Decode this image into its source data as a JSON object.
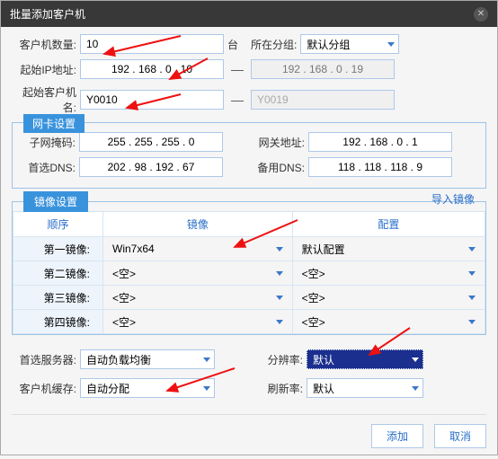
{
  "title": "批量添加客户机",
  "client_count_label": "客户机数量:",
  "client_count_value": "10",
  "client_count_unit": "台",
  "group_in_label": "所在分组:",
  "group_in_value": "默认分组",
  "start_ip_label": "起始IP地址:",
  "start_ip_value": "192 . 168 . 0 . 10",
  "end_ip_value": "192 . 168 . 0 . 19",
  "start_name_label": "起始客户机名:",
  "start_name_value": "Y0010",
  "end_name_value": "Y0019",
  "nic_title": "网卡设置",
  "subnet_label": "子网掩码:",
  "subnet_value": "255 . 255 . 255 . 0",
  "gateway_label": "网关地址:",
  "gateway_value": "192 . 168 . 0 . 1",
  "dns1_label": "首选DNS:",
  "dns1_value": "202 . 98 . 192 . 67",
  "dns2_label": "备用DNS:",
  "dns2_value": "118 . 118 . 118 . 9",
  "img_title": "镜像设置",
  "import_label": "导入镜像",
  "th_order": "顺序",
  "th_image": "镜像",
  "th_config": "配置",
  "rows": [
    {
      "name": "第一镜像:",
      "image": "Win7x64",
      "config": "默认配置"
    },
    {
      "name": "第二镜像:",
      "image": "<空>",
      "config": "<空>"
    },
    {
      "name": "第三镜像:",
      "image": "<空>",
      "config": "<空>"
    },
    {
      "name": "第四镜像:",
      "image": "<空>",
      "config": "<空>"
    }
  ],
  "pref_server_label": "首选服务器:",
  "pref_server_value": "自动负载均衡",
  "resolution_label": "分辨率:",
  "resolution_value": "默认",
  "client_cache_label": "客户机缓存:",
  "client_cache_value": "自动分配",
  "refresh_rate_label": "刷新率:",
  "refresh_rate_value": "默认",
  "btn_add": "添加",
  "btn_cancel": "取消"
}
